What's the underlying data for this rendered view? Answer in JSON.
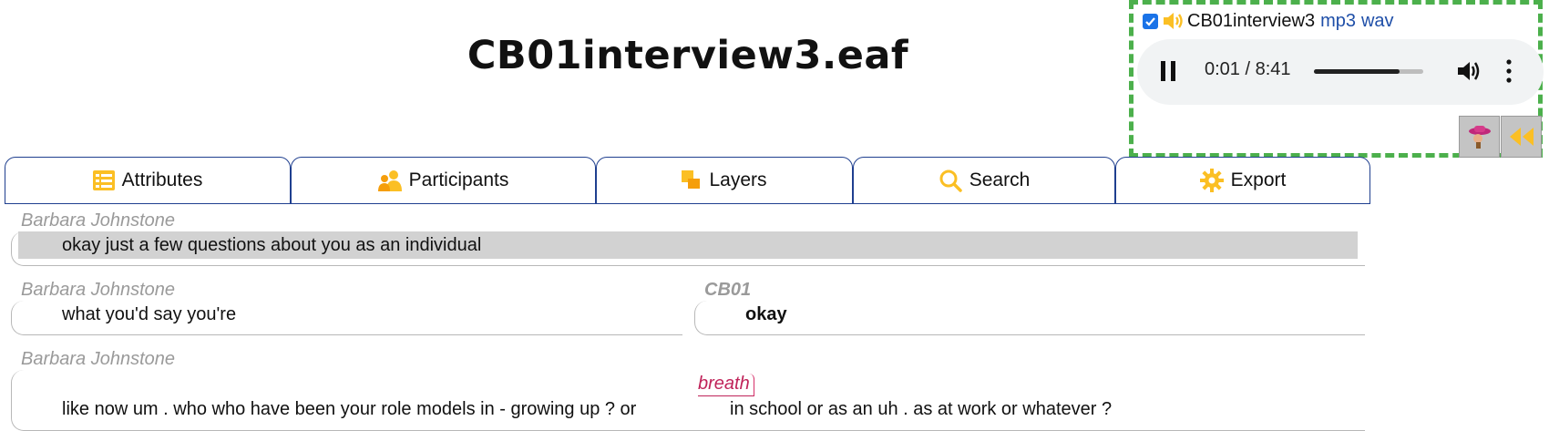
{
  "page": {
    "title": "CB01interview3.eaf"
  },
  "media": {
    "file_name": "CB01interview3",
    "links": [
      "mp3",
      "wav"
    ],
    "time": "0:01 / 8:41",
    "progress": 0.78,
    "checkbox_checked": true,
    "icons": [
      "speaker-icon",
      "play-pause-icon",
      "volume-icon",
      "more-options-icon",
      "praat-icon",
      "rewind-icon"
    ],
    "accent_color": "#fbbf24",
    "border_color": "#4cb04c"
  },
  "tabs": [
    {
      "label": "Attributes",
      "icon": "attributes-icon"
    },
    {
      "label": "Participants",
      "icon": "participants-icon"
    },
    {
      "label": "Layers",
      "icon": "layers-icon"
    },
    {
      "label": "Search",
      "icon": "search-icon"
    },
    {
      "label": "Export",
      "icon": "gear-icon"
    }
  ],
  "transcript": {
    "turns": [
      {
        "speaker": "Barbara Johnstone",
        "text": "okay just a few questions about you as an individual"
      },
      {
        "speaker": "Barbara Johnstone",
        "text": "what you'd say you're"
      },
      {
        "speaker": "CB01",
        "text": "okay"
      },
      {
        "speaker": "Barbara Johnstone",
        "text_before": "like now um . who who have been your role models in - growing up ? or",
        "noise": "breath",
        "text_after": "in school or as an uh . as at work or whatever ?"
      }
    ]
  }
}
